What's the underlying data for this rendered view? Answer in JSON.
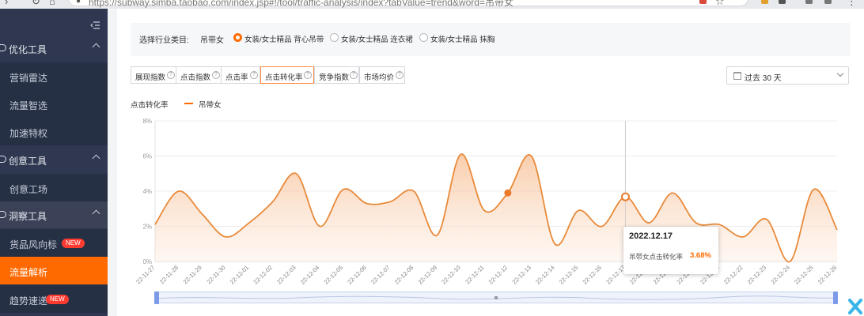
{
  "browser": {
    "url": "https://subway.simba.taobao.com/index.jsp#!/tool/traffic-analysis/index?tabValue=trend&word=吊带女"
  },
  "sidebar": {
    "groups": [
      {
        "label": "优化工具",
        "items": [
          "营销雷达",
          "流量智选",
          "加速特权"
        ]
      },
      {
        "label": "创意工具",
        "items": [
          "创意工场"
        ]
      },
      {
        "label": "洞察工具",
        "items": [
          "货品风向标",
          "流量解析",
          "趋势速递"
        ]
      }
    ],
    "badges": {
      "new1": "NEW",
      "new2": "NEW"
    },
    "active_item": "流量解析"
  },
  "filter": {
    "label": "选择行业类目:",
    "keyword": "吊带女",
    "options": [
      "女装/女士精品 背心吊带",
      "女装/女士精品 连衣裙",
      "女装/女士精品 抹胸"
    ],
    "selected_index": 0
  },
  "tabs": [
    "展现指数",
    "点击指数",
    "点击率",
    "点击转化率",
    "竞争指数",
    "市场均价"
  ],
  "tab_help": "?",
  "active_tab": "点击转化率",
  "date_range": {
    "label": "过去 30 天"
  },
  "legend": {
    "metric": "点击转化率",
    "series": "吊带女"
  },
  "tooltip": {
    "date": "2022.12.17",
    "label": "吊带女点击转化率",
    "value": "3.68%"
  },
  "colors": {
    "accent": "#ff6a00",
    "sidebar_bg": "#2f3850",
    "series": "#e88a3a"
  },
  "chart_data": {
    "type": "area",
    "x": [
      "22-11-27",
      "22-11-28",
      "22-11-29",
      "22-11-30",
      "22-12-01",
      "22-12-02",
      "22-12-03",
      "22-12-04",
      "22-12-05",
      "22-12-06",
      "22-12-07",
      "22-12-08",
      "22-12-09",
      "22-12-10",
      "22-12-11",
      "22-12-12",
      "22-12-13",
      "22-12-14",
      "22-12-15",
      "22-12-16",
      "22-12-17",
      "22-12-18",
      "22-12-19",
      "22-12-20",
      "22-12-21",
      "22-12-22",
      "22-12-23",
      "22-12-24",
      "22-12-25",
      "22-12-26"
    ],
    "series": [
      {
        "name": "吊带女",
        "values": [
          2.1,
          4.0,
          2.7,
          1.4,
          2.2,
          3.4,
          5.0,
          2.0,
          4.1,
          3.3,
          3.4,
          4.0,
          1.5,
          6.1,
          2.9,
          3.9,
          6.0,
          1.0,
          2.9,
          2.0,
          3.68,
          2.2,
          3.9,
          2.2,
          2.1,
          1.4,
          2.4,
          0.0,
          4.1,
          1.8
        ]
      }
    ],
    "y_ticks": [
      "0%",
      "2%",
      "4%",
      "6%",
      "8%"
    ],
    "ylim": [
      0,
      8
    ],
    "highlight_index": 20,
    "marker_index": 15,
    "grid": true
  }
}
